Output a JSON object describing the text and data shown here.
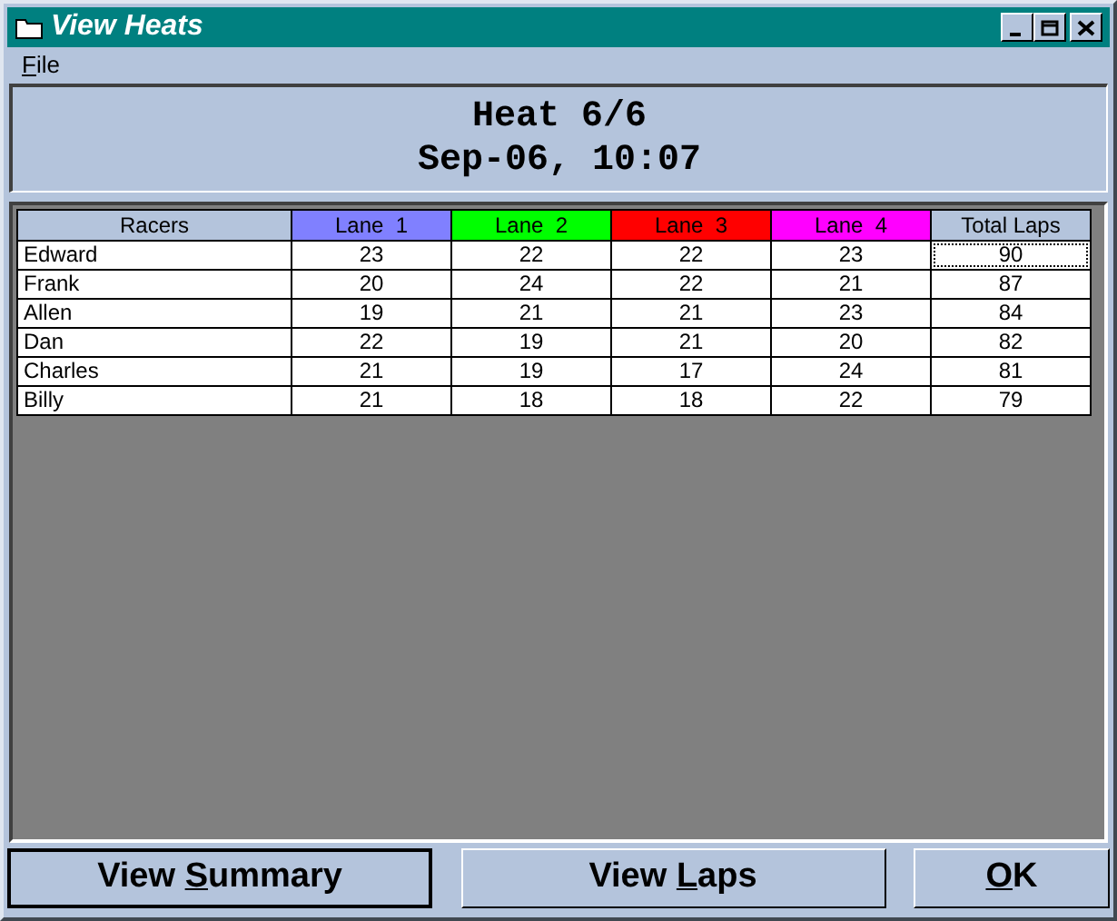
{
  "window": {
    "title": "View Heats"
  },
  "menu": [
    {
      "key": "F",
      "post": "ile"
    }
  ],
  "header": {
    "line1": "Heat 6/6",
    "line2": "Sep-06, 10:07"
  },
  "table": {
    "columns": [
      {
        "label": "Racers",
        "color": "#b4c4dc"
      },
      {
        "label": "Lane  1",
        "color": "#8080ff"
      },
      {
        "label": "Lane  2",
        "color": "#00ff00"
      },
      {
        "label": "Lane  3",
        "color": "#ff0000"
      },
      {
        "label": "Lane  4",
        "color": "#ff00ff"
      },
      {
        "label": "Total Laps",
        "color": "#b4c4dc"
      }
    ],
    "rows": [
      {
        "cells": [
          "Edward",
          "23",
          "22",
          "22",
          "23",
          "90"
        ],
        "focused": true
      },
      {
        "cells": [
          "Frank",
          "20",
          "24",
          "22",
          "21",
          "87"
        ],
        "focused": false
      },
      {
        "cells": [
          "Allen",
          "19",
          "21",
          "21",
          "23",
          "84"
        ],
        "focused": false
      },
      {
        "cells": [
          "Dan",
          "22",
          "19",
          "21",
          "20",
          "82"
        ],
        "focused": false
      },
      {
        "cells": [
          "Charles",
          "21",
          "19",
          "17",
          "24",
          "81"
        ],
        "focused": false
      },
      {
        "cells": [
          "Billy",
          "21",
          "18",
          "18",
          "22",
          "79"
        ],
        "focused": false
      }
    ]
  },
  "buttons": [
    {
      "pre": "View ",
      "key": "S",
      "post": "ummary",
      "default": true
    },
    {
      "pre": "View ",
      "key": "L",
      "post": "aps",
      "default": false
    },
    {
      "key": "O",
      "post": "K",
      "default": false
    }
  ]
}
